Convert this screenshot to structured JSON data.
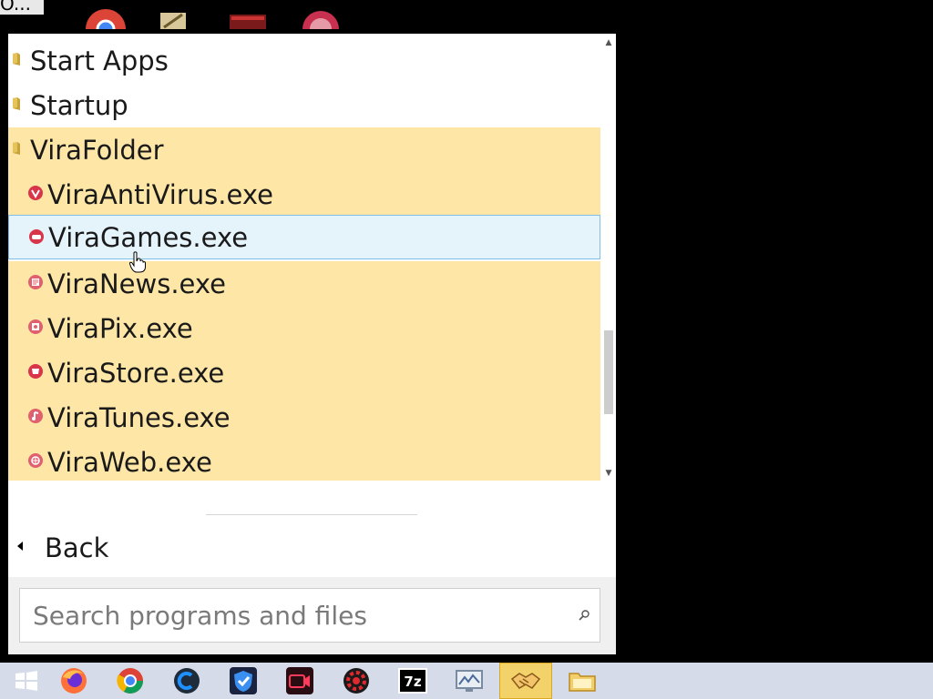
{
  "desktop": {
    "partial_label": "O..."
  },
  "start_menu": {
    "items": [
      {
        "label": "Start Apps",
        "kind": "folder",
        "state": "normal"
      },
      {
        "label": "Startup",
        "kind": "folder",
        "state": "normal"
      },
      {
        "label": "ViraFolder",
        "kind": "folder",
        "state": "highlighted"
      },
      {
        "label": "ViraAntiVirus.exe",
        "kind": "exe",
        "state": "highlighted",
        "icon": "vira-antivirus-icon"
      },
      {
        "label": "ViraGames.exe",
        "kind": "exe",
        "state": "selected",
        "icon": "vira-games-icon"
      },
      {
        "label": "ViraNews.exe",
        "kind": "exe",
        "state": "highlighted",
        "icon": "vira-news-icon"
      },
      {
        "label": "ViraPix.exe",
        "kind": "exe",
        "state": "highlighted",
        "icon": "vira-pix-icon"
      },
      {
        "label": "ViraStore.exe",
        "kind": "exe",
        "state": "highlighted",
        "icon": "vira-store-icon"
      },
      {
        "label": "ViraTunes.exe",
        "kind": "exe",
        "state": "highlighted",
        "icon": "vira-tunes-icon"
      },
      {
        "label": "ViraWeb.exe",
        "kind": "exe",
        "state": "highlighted",
        "icon": "vira-web-icon"
      }
    ],
    "back_label": "Back",
    "search": {
      "placeholder": "Search programs and files",
      "value": ""
    }
  },
  "taskbar": {
    "buttons": [
      {
        "name": "start-button",
        "icon": "windows-icon",
        "active": false
      },
      {
        "name": "firefox-button",
        "icon": "firefox-icon",
        "active": false
      },
      {
        "name": "chrome-button",
        "icon": "chrome-icon",
        "active": false
      },
      {
        "name": "ccleaner-button",
        "icon": "ccleaner-icon",
        "active": false
      },
      {
        "name": "shield-app-button",
        "icon": "shield-icon",
        "active": false
      },
      {
        "name": "video-recorder-button",
        "icon": "video-camera-icon",
        "active": false
      },
      {
        "name": "gear-app-button",
        "icon": "gear-icon",
        "active": false
      },
      {
        "name": "7zip-button",
        "icon": "7zip-icon",
        "active": false,
        "text": "7z"
      },
      {
        "name": "monitor-app-button",
        "icon": "monitor-icon",
        "active": false
      },
      {
        "name": "sync-center-button",
        "icon": "handshake-icon",
        "active": true
      },
      {
        "name": "file-explorer-button",
        "icon": "folder-icon",
        "active": false
      }
    ]
  },
  "colors": {
    "highlight": "#fde6a6",
    "selected": "#e5f3fb",
    "taskbar": "#d6dbe9"
  }
}
